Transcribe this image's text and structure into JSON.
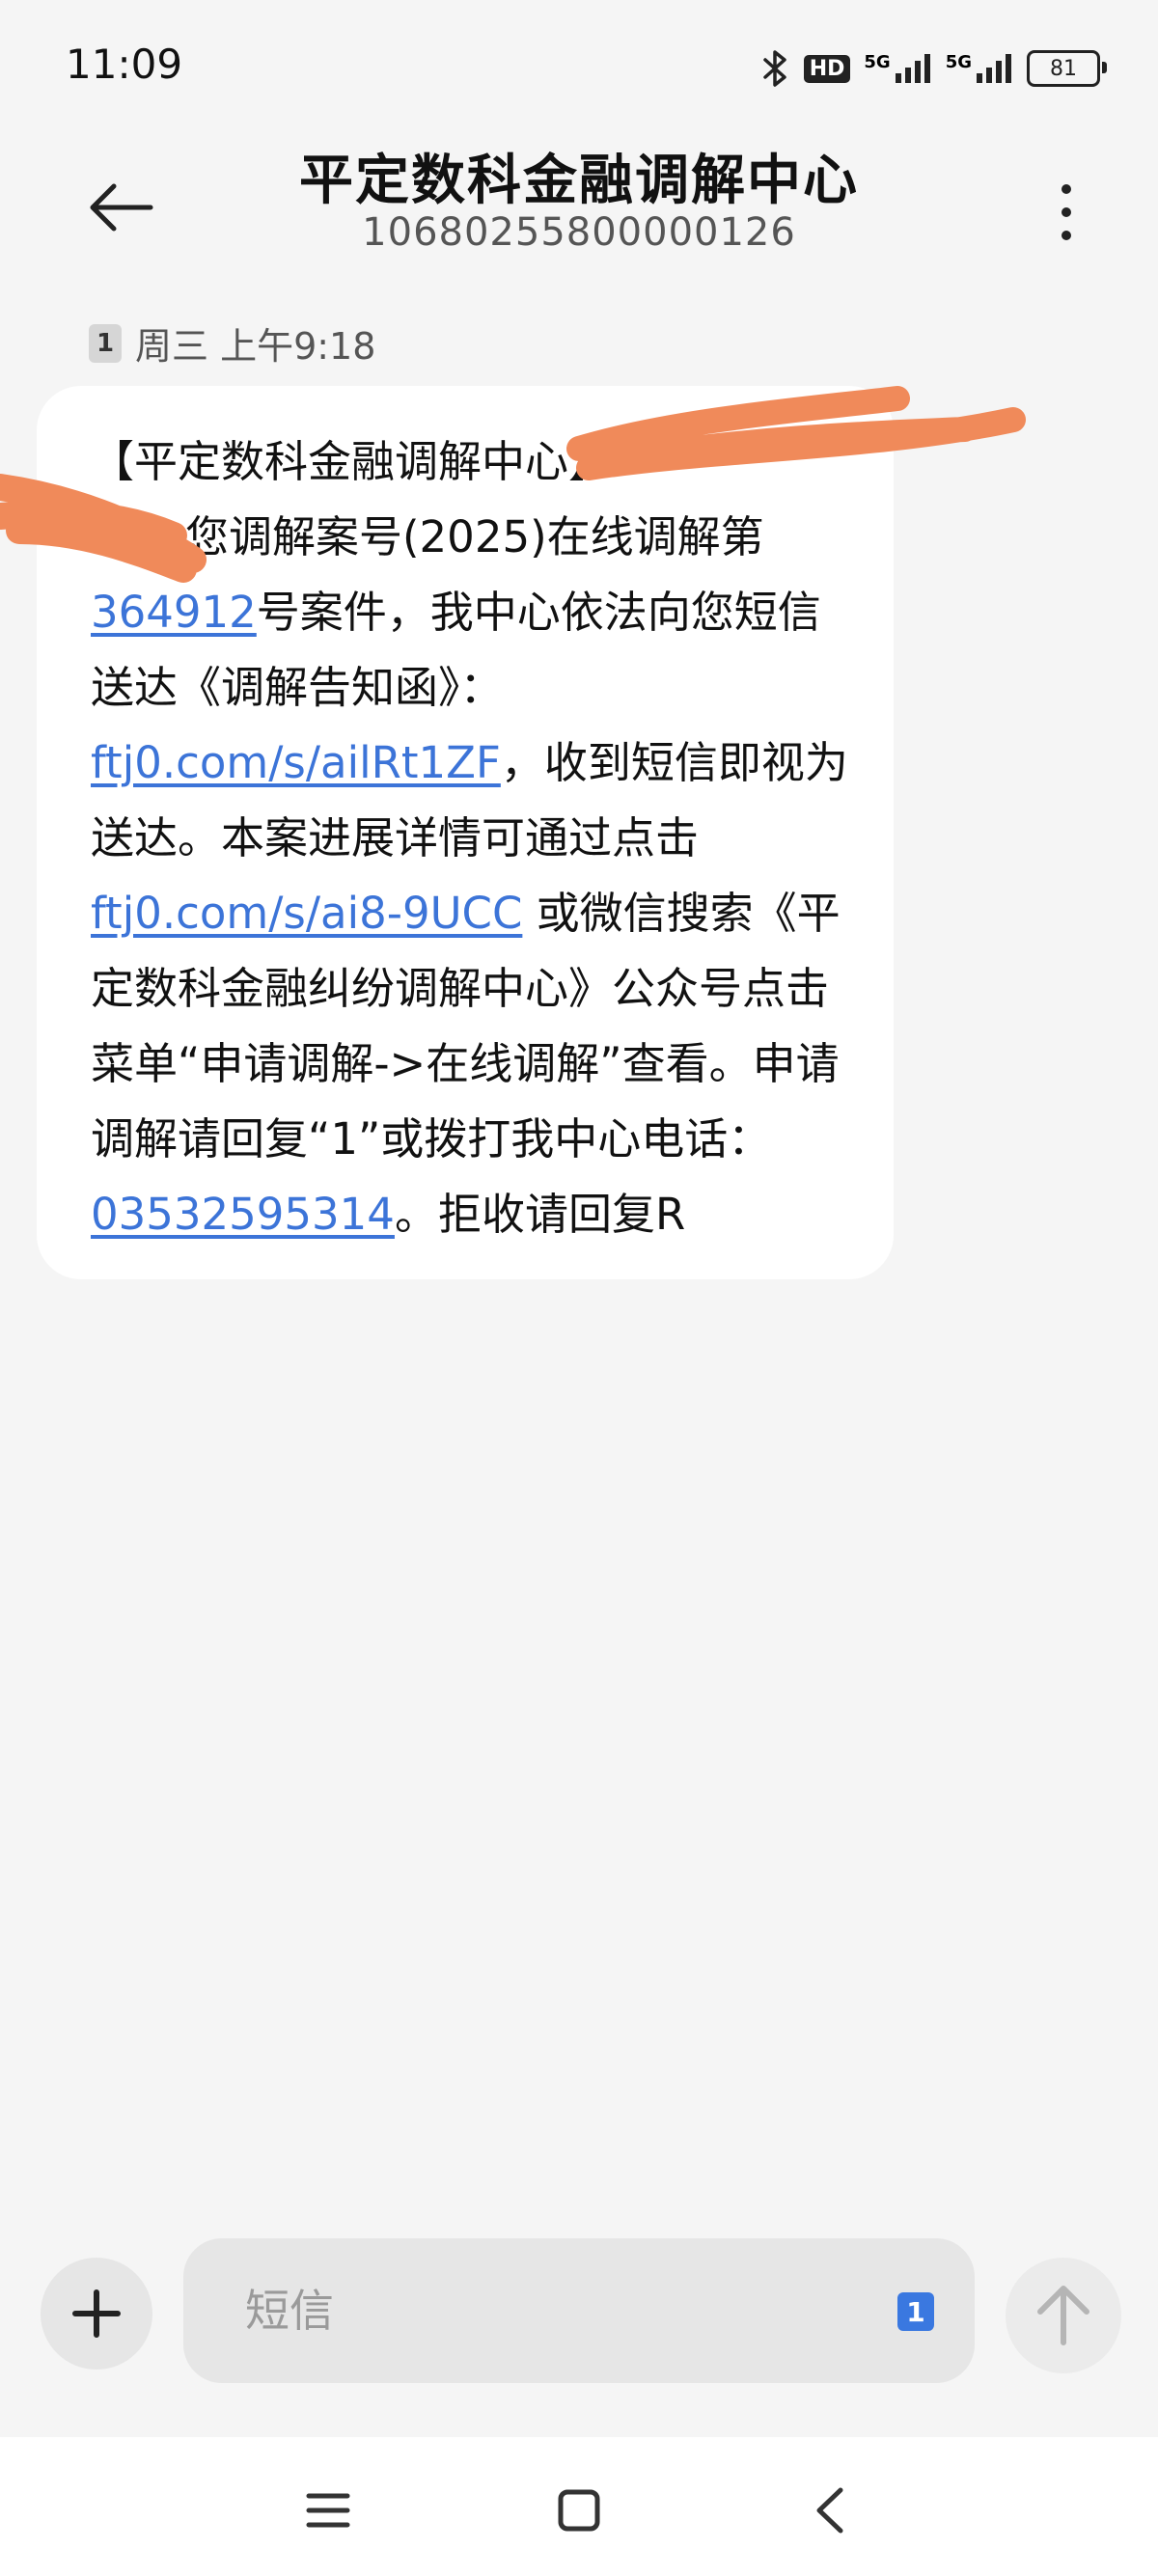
{
  "status_bar": {
    "time": "11:09",
    "battery_level": "81",
    "signal_1_label": "5G",
    "signal_2_label": "5G",
    "hd_label": "HD"
  },
  "header": {
    "title": "平定数科金融调解中心",
    "subtitle": "10680255800000126"
  },
  "conversation": {
    "sim_label": "1",
    "timestamp": "周三 上午9:18"
  },
  "message": {
    "line1": "【平定数科金融调解中心】",
    "seg_a": "您调解案号(2025)在线调解第",
    "case_link": "364912",
    "seg_b": "号案件，我中心依法向您短信送达《调解告知函》：",
    "link1": "ftj0.com/s/ailRt1ZF",
    "seg_c": "，收到短信即视为送达。本案进展详情可通过点击",
    "link2": "ftj0.com/s/ai8-9UCC",
    "seg_d": " 或微信搜索《平定数科金融纠纷调解中心》公众号点击菜单“申请调解->在线调解”查看。申请调解请回复“1”或拨打我中心电话：",
    "phone_link": "03532595314",
    "seg_e": "。拒收请回复R"
  },
  "composer": {
    "placeholder": "短信",
    "sim_label": "1"
  },
  "colors": {
    "link": "#3c74d8",
    "redaction": "#f08a5a",
    "sim_badge_active": "#3a78e0"
  },
  "icons": [
    "back-arrow-icon",
    "more-vert-icon",
    "plus-icon",
    "send-arrow-icon",
    "bluetooth-icon",
    "menu-icon",
    "home-square-icon",
    "back-chevron-icon"
  ]
}
